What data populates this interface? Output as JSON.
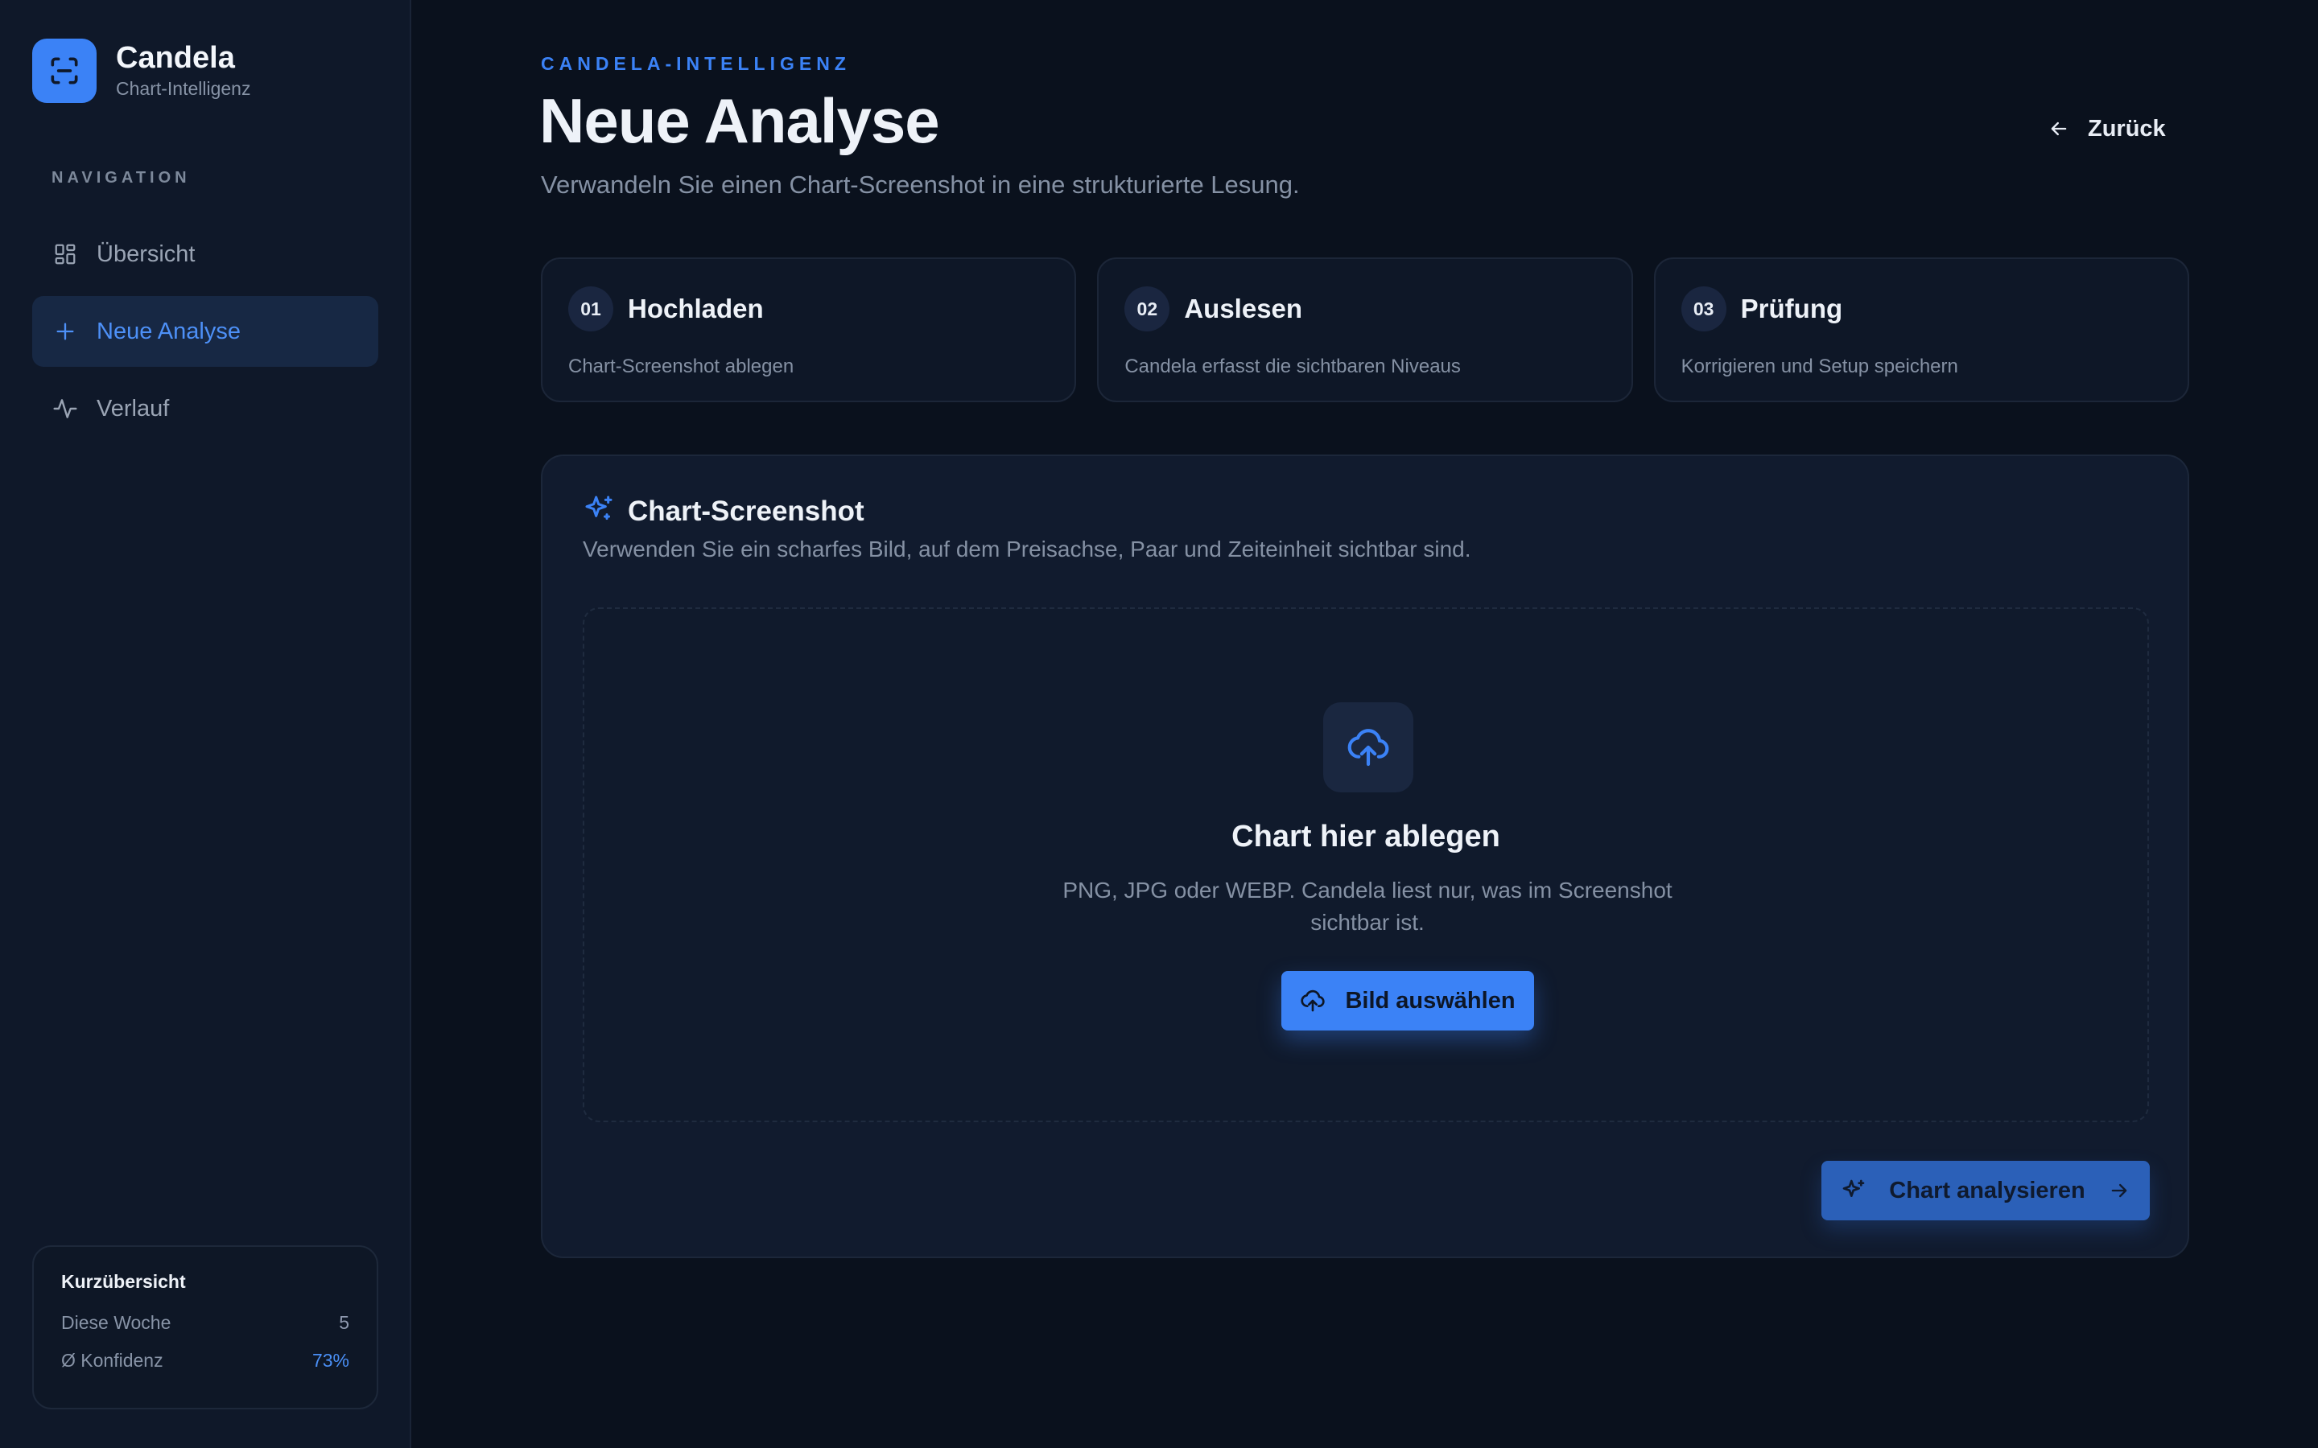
{
  "brand": {
    "name": "Candela",
    "subtitle": "Chart-Intelligenz",
    "logo_icon": "scan-icon"
  },
  "sidebar": {
    "nav_heading": "NAVIGATION",
    "items": [
      {
        "label": "Übersicht",
        "icon": "dashboard-icon",
        "active": false
      },
      {
        "label": "Neue Analyse",
        "icon": "plus-icon",
        "active": true
      },
      {
        "label": "Verlauf",
        "icon": "activity-icon",
        "active": false
      }
    ],
    "summary": {
      "title": "Kurzübersicht",
      "rows": [
        {
          "label": "Diese Woche",
          "value": "5"
        },
        {
          "label": "Ø Konfidenz",
          "value": "73%"
        }
      ]
    }
  },
  "header": {
    "eyebrow": "CANDELA-INTELLIGENZ",
    "title": "Neue Analyse",
    "subtitle": "Verwandeln Sie einen Chart-Screenshot in eine strukturierte Lesung.",
    "back_label": "Zurück"
  },
  "steps": [
    {
      "num": "01",
      "title": "Hochladen",
      "desc": "Chart-Screenshot ablegen"
    },
    {
      "num": "02",
      "title": "Auslesen",
      "desc": "Candela erfasst die sichtbaren Niveaus"
    },
    {
      "num": "03",
      "title": "Prüfung",
      "desc": "Korrigieren und Setup speichern"
    }
  ],
  "upload_card": {
    "title": "Chart-Screenshot",
    "subtitle": "Verwenden Sie ein scharfes Bild, auf dem Preisachse, Paar und Zeiteinheit sichtbar sind.",
    "drop_title": "Chart hier ablegen",
    "drop_hint": "PNG, JPG oder WEBP. Candela liest nur, was im Screenshot sichtbar ist.",
    "choose_label": "Bild auswählen",
    "analyze_label": "Chart analysieren"
  },
  "colors": {
    "accent": "#3b82f6",
    "background": "#0a111d",
    "sidebar": "#0f1829",
    "card": "#111b2e"
  }
}
